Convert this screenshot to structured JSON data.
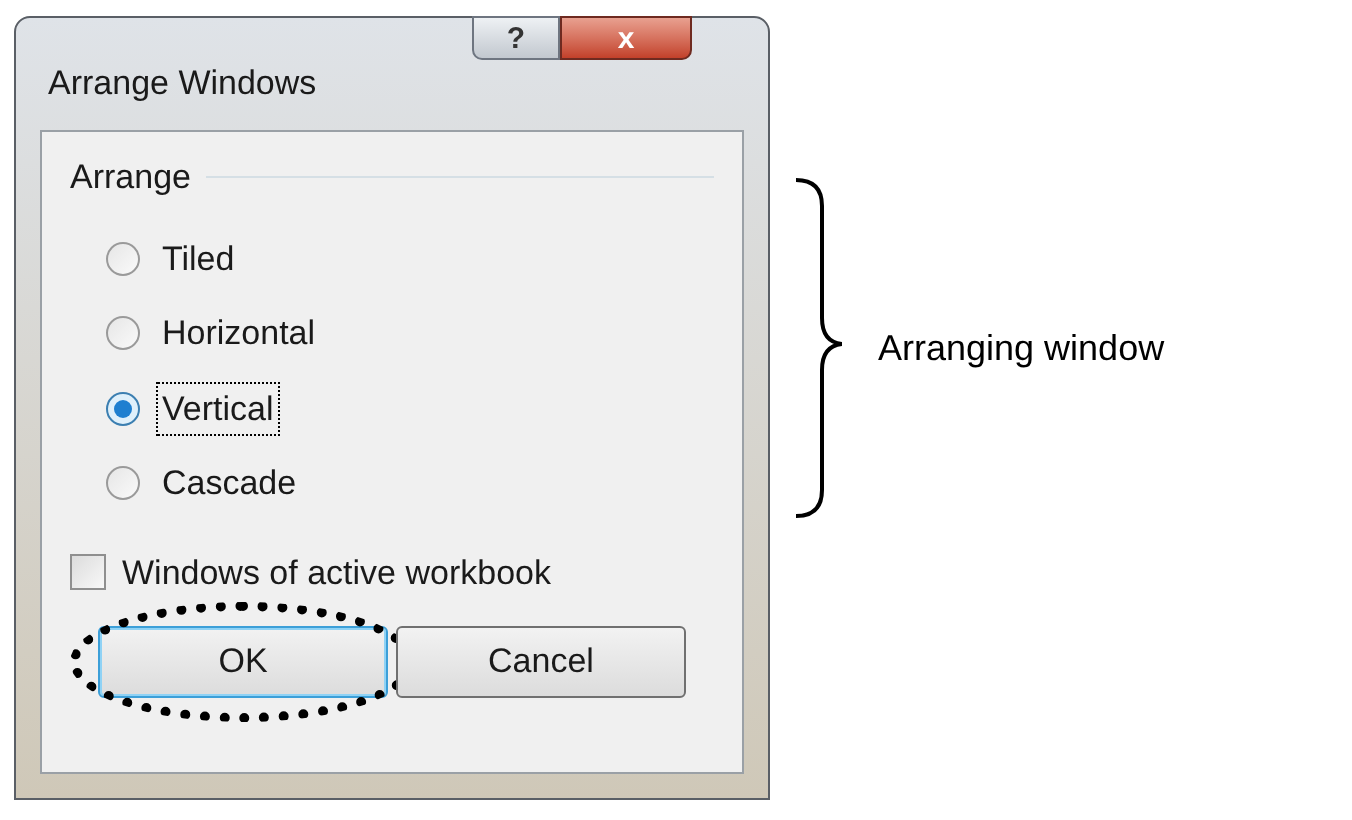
{
  "window": {
    "title": "Arrange Windows",
    "help_button": "?",
    "close_button": "x"
  },
  "group": {
    "title": "Arrange"
  },
  "options": [
    {
      "label": "Tiled",
      "selected": false,
      "focused": false
    },
    {
      "label": "Horizontal",
      "selected": false,
      "focused": false
    },
    {
      "label": "Vertical",
      "selected": true,
      "focused": true
    },
    {
      "label": "Cascade",
      "selected": false,
      "focused": false
    }
  ],
  "checkbox": {
    "label": "Windows of active workbook",
    "checked": false
  },
  "buttons": [
    {
      "label": "OK",
      "default": true,
      "highlighted": true
    },
    {
      "label": "Cancel",
      "default": false,
      "highlighted": false
    }
  ],
  "annotation": {
    "label": "Arranging window"
  }
}
